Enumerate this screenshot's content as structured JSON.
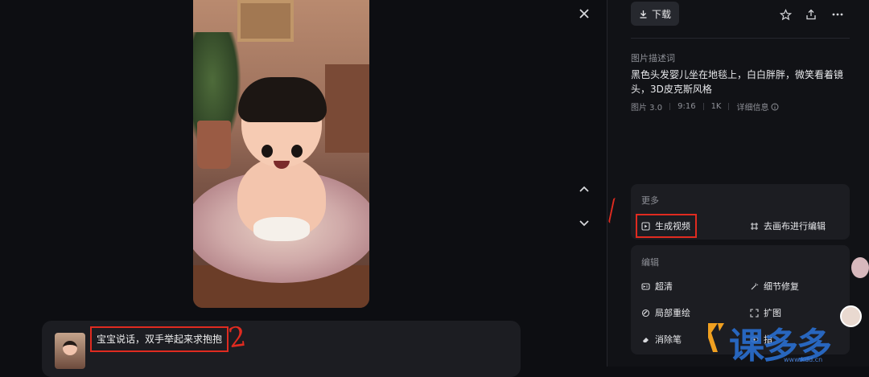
{
  "viewer": {
    "close_icon": "close-icon",
    "prev_icon": "chevron-up-icon",
    "next_icon": "chevron-down-icon"
  },
  "prompt": {
    "text": "宝宝说话，双手举起来求抱抱"
  },
  "annotations": {
    "mark1": "1",
    "mark2": "2"
  },
  "toolbar": {
    "download_label": "下载",
    "star_icon": "star-icon",
    "share_icon": "share-icon",
    "more_icon": "more-icon"
  },
  "details": {
    "label": "图片描述词",
    "description": "黑色头发婴儿坐在地毯上，白白胖胖，微笑看着镜头，3D皮克斯风格",
    "meta": [
      "图片 3.0",
      "9:16",
      "1K",
      "详细信息"
    ]
  },
  "more_section": {
    "title": "更多",
    "items": [
      "生成视频",
      "去画布进行编辑"
    ]
  },
  "edit_section": {
    "title": "编辑",
    "items": [
      "超清",
      "细节修复",
      "局部重绘",
      "扩图",
      "消除笔",
      "指"
    ]
  },
  "watermark": {
    "text": "课多多",
    "url": "www.kdd.cn"
  },
  "colors": {
    "accent_red": "#e02b20",
    "panel": "#1c1d22",
    "background": "#0d0e12"
  }
}
